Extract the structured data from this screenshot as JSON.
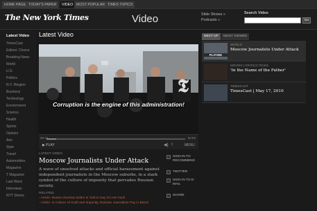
{
  "topnav": {
    "tabs": [
      {
        "label": "Home Page",
        "active": false
      },
      {
        "label": "Today's Paper",
        "active": false
      },
      {
        "label": "Video",
        "active": true
      },
      {
        "label": "Most Popular",
        "active": false
      },
      {
        "label": "Times Topics",
        "active": false
      }
    ]
  },
  "header": {
    "logo": "The New York Times",
    "section_title": "Video",
    "links": [
      "Slide Shows »",
      "Podcasts »"
    ],
    "search_label": "Search Video",
    "search_placeholder": "",
    "search_button": "Go"
  },
  "sidebar": {
    "items": [
      {
        "label": "Latest Video",
        "active": true
      },
      {
        "label": "TimesCast"
      },
      {
        "label": "Editors' Choice"
      },
      {
        "label": "Breaking News"
      },
      {
        "label": "World"
      },
      {
        "label": "U.S."
      },
      {
        "label": "Politics"
      },
      {
        "label": "N.Y. /Region"
      },
      {
        "label": "Business"
      },
      {
        "label": "Technology"
      },
      {
        "label": "Environment"
      },
      {
        "label": "Science"
      },
      {
        "label": "Health"
      },
      {
        "label": "Sports"
      },
      {
        "label": "Opinion"
      },
      {
        "label": "Arts"
      },
      {
        "label": "Style"
      },
      {
        "label": "Travel"
      },
      {
        "label": "Automobiles"
      },
      {
        "label": "Magazine"
      },
      {
        "label": "T Magazine"
      },
      {
        "label": "Last Word"
      },
      {
        "label": "Interviews"
      },
      {
        "label": "NYT Shorts"
      }
    ]
  },
  "main": {
    "title": "Latest Video",
    "subtitle": "Corruption is the engine of this administration!",
    "time_elapsed": "00:12",
    "time_total": "02:53",
    "progress": 0.07,
    "controls": {
      "play": "PLAY",
      "share": "SHARE",
      "menu": "MENU"
    },
    "kicker": "Latest Video",
    "headline": "Moscow Journalists Under Attack",
    "description": "A wave of unsolved attacks and official harassment against independent journalists in the Moscow suburbs, in a stark symbol of the culture of impunity that pervades Russian society.",
    "related_label": "Related",
    "related": [
      "- Article: Beaten Russian Editor Is Told to Say It's His Fault",
      "- Article: In Culture of Graft and Impunity, Russian Journalists Pay in Blood"
    ],
    "share": [
      {
        "label": "Sign in to Recommend"
      },
      {
        "label": "Twitter"
      },
      {
        "label": "Sign in to E-Mail"
      },
      {
        "label": "Share"
      }
    ]
  },
  "right": {
    "tabs": [
      {
        "label": "Next Up",
        "active": true
      },
      {
        "label": "Most Viewed",
        "active": false
      }
    ],
    "items": [
      {
        "category": "World",
        "title": "Moscow Journalists Under Attack",
        "playing_label": "PLAYING",
        "active": true
      },
      {
        "category": "Movies | Critics' Picks",
        "title": "'In the Name of the Father'"
      },
      {
        "category": "TimesCast",
        "title": "TimesCast | May 17, 2010"
      }
    ]
  }
}
